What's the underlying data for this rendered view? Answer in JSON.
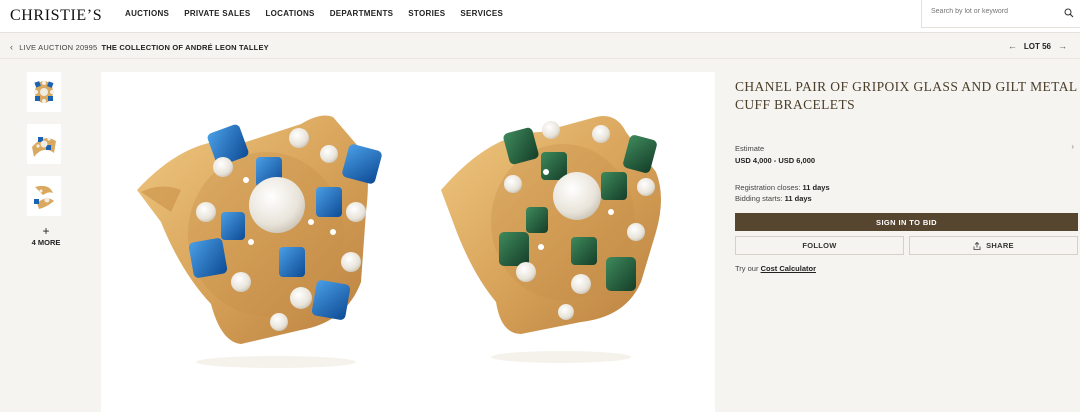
{
  "brand": {
    "logo_text": "CHRISTIE’S"
  },
  "nav": {
    "items": [
      "AUCTIONS",
      "PRIVATE SALES",
      "LOCATIONS",
      "DEPARTMENTS",
      "STORIES",
      "SERVICES"
    ]
  },
  "search": {
    "placeholder": "Search by lot or keyword",
    "icon": "search-icon"
  },
  "breadcrumb": {
    "auction": "LIVE AUCTION 20995",
    "collection": "THE COLLECTION OF ANDRÉ LEON TALLEY"
  },
  "lot_nav": {
    "label": "LOT 56"
  },
  "gallery": {
    "more_label": "4 MORE"
  },
  "lot": {
    "title": "CHANEL PAIR OF GRIPOIX GLASS AND GILT METAL CUFF BRACELETS",
    "estimate_label": "Estimate",
    "estimate_value": "USD 4,000 - USD 6,000",
    "registration_label": "Registration closes:",
    "registration_value": "11 days",
    "bidding_label": "Bidding starts:",
    "bidding_value": "11 days"
  },
  "actions": {
    "sign_in": "SIGN IN TO BID",
    "follow": "FOLLOW",
    "share": "SHARE",
    "calc_prefix": "Try our",
    "calc_link": "Cost Calculator"
  },
  "colors": {
    "accent": "#564630",
    "title": "#4a3d2a",
    "background": "#f6f4f0",
    "gold": "#d9a960",
    "blue_stone": "#1c62b3",
    "green_stone": "#1f5a3a"
  }
}
